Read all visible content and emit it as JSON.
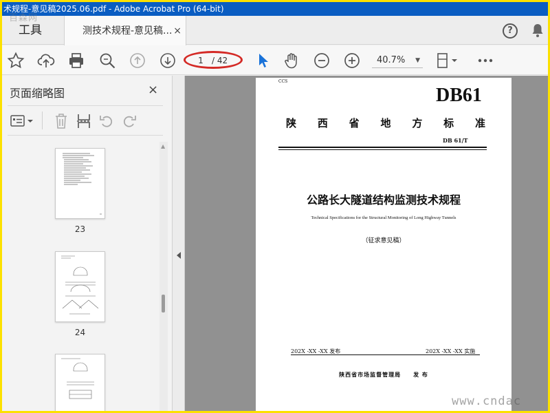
{
  "window": {
    "title": "术规程-意见稿2025.06.pdf - Adobe Acrobat Pro (64-bit)"
  },
  "watermarks": {
    "top_left": "百森网",
    "bottom_right": "www.cndac"
  },
  "tabs": {
    "tools": "工具",
    "document": "测技术规程-意见稿...",
    "close": "×"
  },
  "toolbar": {
    "current_page": "1",
    "total_pages": "/ 42",
    "zoom": "40.7%",
    "icons": [
      "star-icon",
      "cloud-upload-icon",
      "print-icon",
      "zoom-search-icon",
      "page-up-icon",
      "page-down-icon",
      "select-arrow-icon",
      "hand-icon",
      "zoom-out-icon",
      "zoom-in-icon",
      "page-view-icon",
      "more-icon"
    ]
  },
  "thumbnail_panel": {
    "title": "页面缩略图",
    "close": "×",
    "pages": [
      {
        "label": "23"
      },
      {
        "label": "24"
      },
      {
        "label": ""
      }
    ]
  },
  "document": {
    "ccs": "CCS",
    "code": "DB61",
    "province_chars": [
      "陕",
      "西",
      "省",
      "地",
      "方",
      "标",
      "准"
    ],
    "number": "DB 61/T",
    "title_cn": "公路长大隧道结构监测技术规程",
    "title_en": "Technical Specifications for the Structural Monitoring of Long Highway Tunnels",
    "draft_note": "（征求意见稿）",
    "issue_date": "202X -XX -XX 发布",
    "impl_date": "202X -XX -XX 实施",
    "publisher": "陕西省市场监督管理局　　发  布"
  },
  "colors": {
    "title_bar": "#0a5dc2",
    "frame": "#fce100",
    "annotation_ring": "#d42a26",
    "doc_bg": "#919191"
  }
}
